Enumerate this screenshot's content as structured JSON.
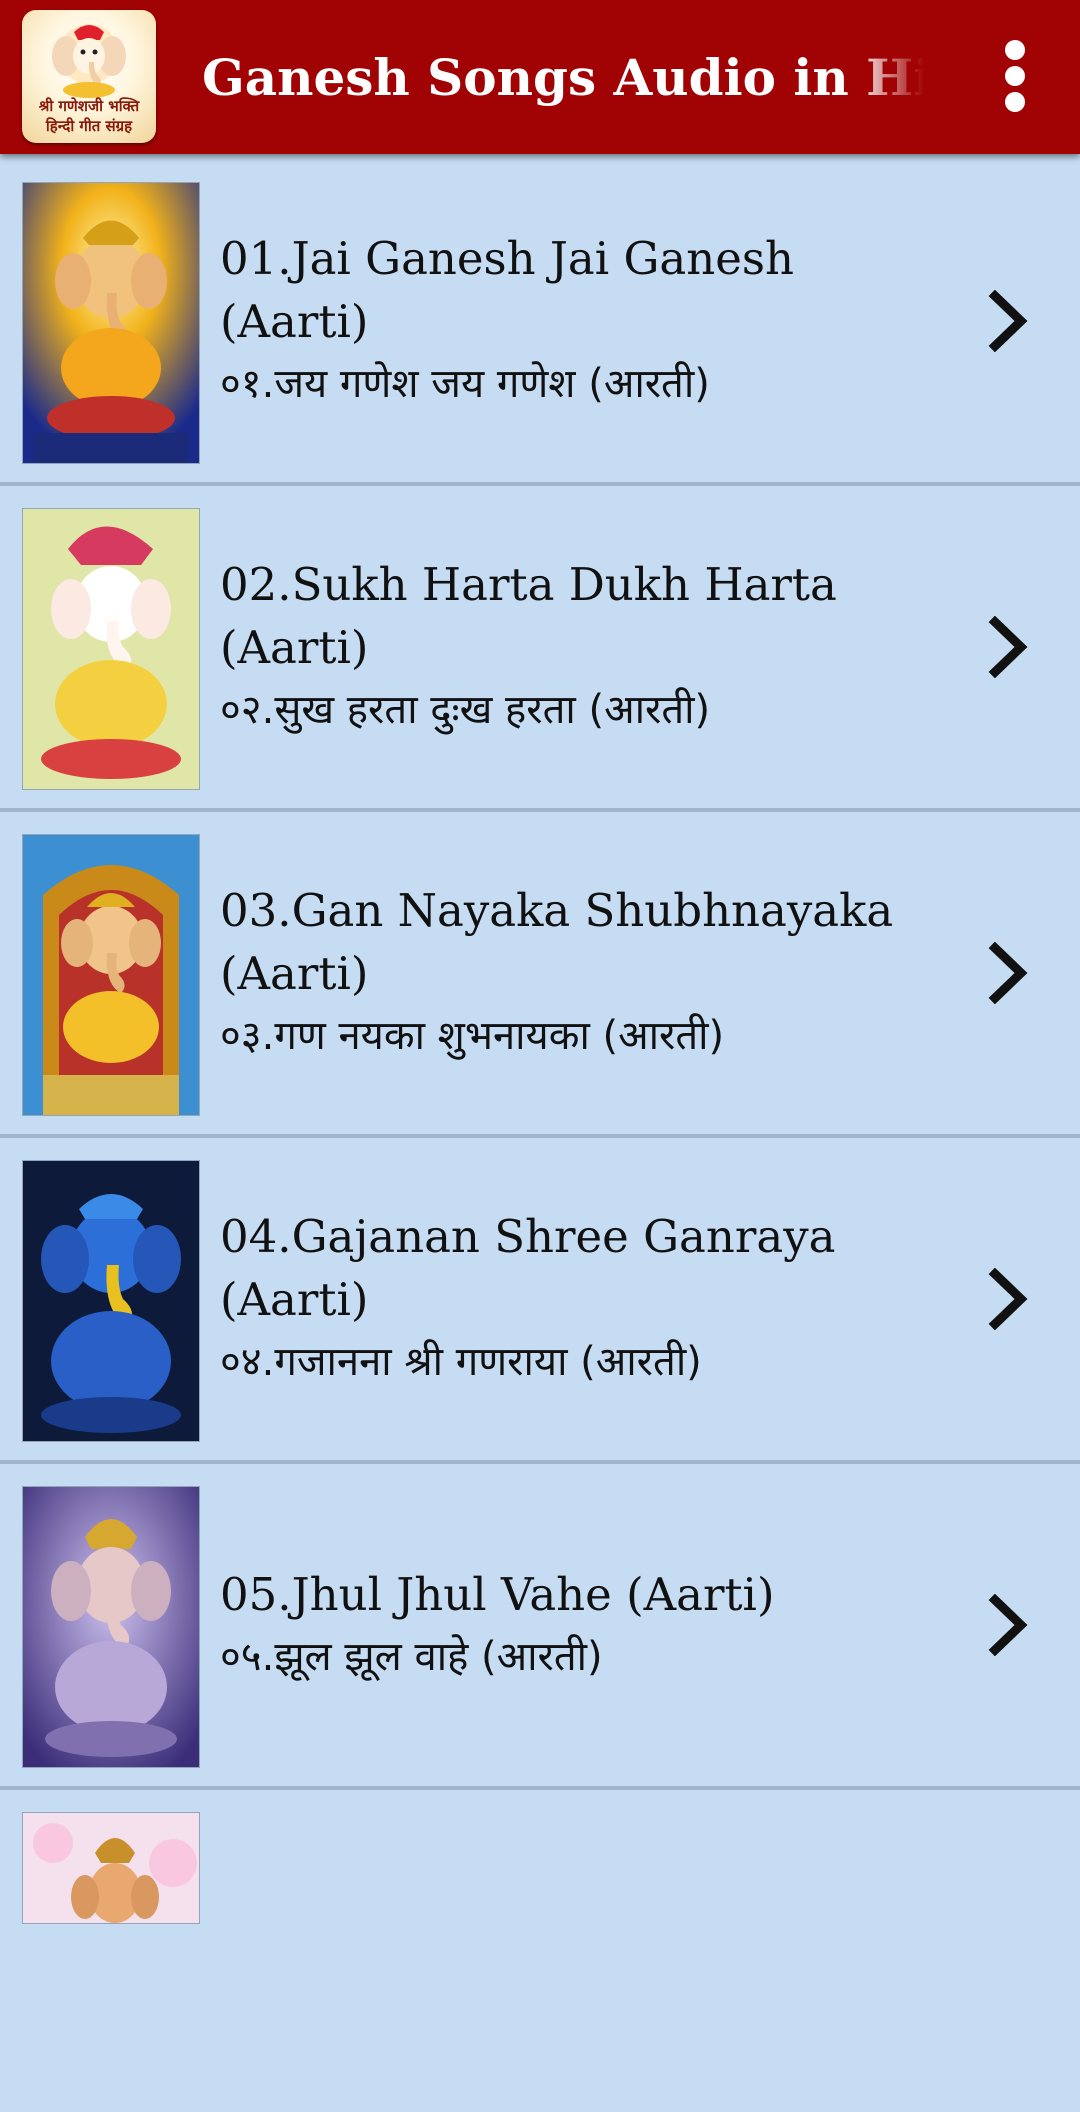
{
  "app_bar": {
    "title": "Ganesh Songs Audio in Hindi",
    "logo_line1": "श्री गणेशजी भक्ति",
    "logo_line2": "हिन्दी गीत संग्रह",
    "logo_icon": "ganesha-logo-icon",
    "menu_icon": "more-vert-icon",
    "color": "#a10203"
  },
  "colors": {
    "list_background": "#c5dcf3",
    "text": "#111111"
  },
  "songs": [
    {
      "title": "01.Jai Ganesh Jai Ganesh (Aarti)",
      "subtitle": "०१.जय गणेश जय गणेश (आरती)",
      "thumb_icon": "ganesha-image",
      "thumb_bg": "#f2b21a"
    },
    {
      "title": "02.Sukh Harta Dukh Harta (Aarti)",
      "subtitle": "०२.सुख हरता दुःख हरता (आरती)",
      "thumb_icon": "ganesha-image",
      "thumb_bg": "#f6f1c9"
    },
    {
      "title": "03.Gan Nayaka Shubhnayaka (Aarti)",
      "subtitle": "०३.गण नयका शुभनायका (आरती)",
      "thumb_icon": "ganesha-image",
      "thumb_bg": "#3c8fd1"
    },
    {
      "title": "04.Gajanan Shree Ganraya (Aarti)",
      "subtitle": "०४.गजानना श्री गणराया (आरती)",
      "thumb_icon": "ganesha-image",
      "thumb_bg": "#0d1a3a"
    },
    {
      "title": "05.Jhul Jhul Vahe (Aarti)",
      "subtitle": "०५.झूल झूल वाहे (आरती)",
      "thumb_icon": "ganesha-image",
      "thumb_bg": "#3b2d78"
    }
  ]
}
